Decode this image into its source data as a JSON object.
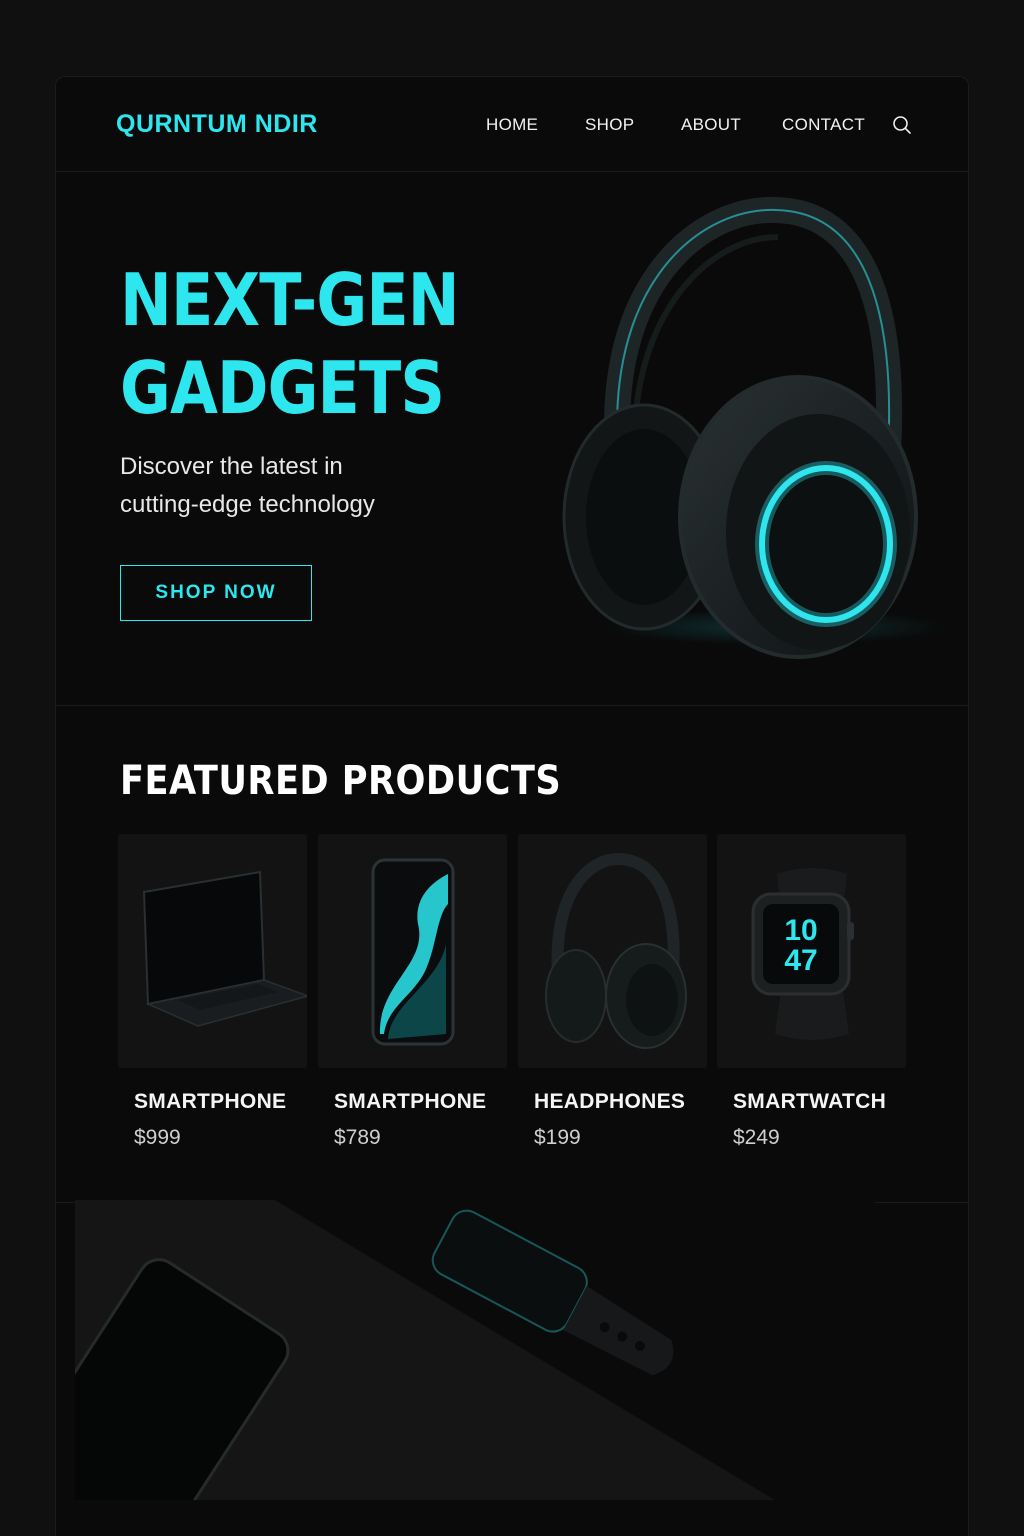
{
  "theme": {
    "accent": "#2de6ee",
    "background": "#0a0a0a",
    "text": "#ffffff"
  },
  "brand": {
    "name": "QURNTUM NDIR"
  },
  "nav": {
    "links": [
      "HOME",
      "SHOP",
      "ABOUT",
      "CONTACT"
    ],
    "search_icon": "search-icon"
  },
  "hero": {
    "title_line1": "NEXT-GEN",
    "title_line2": "GADGETS",
    "subtitle_line1": "Discover the latest in",
    "subtitle_line2": "cutting-edge technology",
    "cta_label": "SHOP NOW",
    "image": "headphones-image"
  },
  "featured": {
    "title": "FEATURED PRODUCTS",
    "products": [
      {
        "name": "SMARTPHONE",
        "price": "$999",
        "image": "laptop-image"
      },
      {
        "name": "SMARTPHONE",
        "price": "$789",
        "image": "smartphone-image"
      },
      {
        "name": "HEADPHONES",
        "price": "$199",
        "image": "headphones-image"
      },
      {
        "name": "SMARTWATCH",
        "price": "$249",
        "image": "smartwatch-image",
        "watch_hour": "10",
        "watch_minute": "47"
      }
    ]
  },
  "banner": {
    "image": "phone-and-watch-image"
  }
}
